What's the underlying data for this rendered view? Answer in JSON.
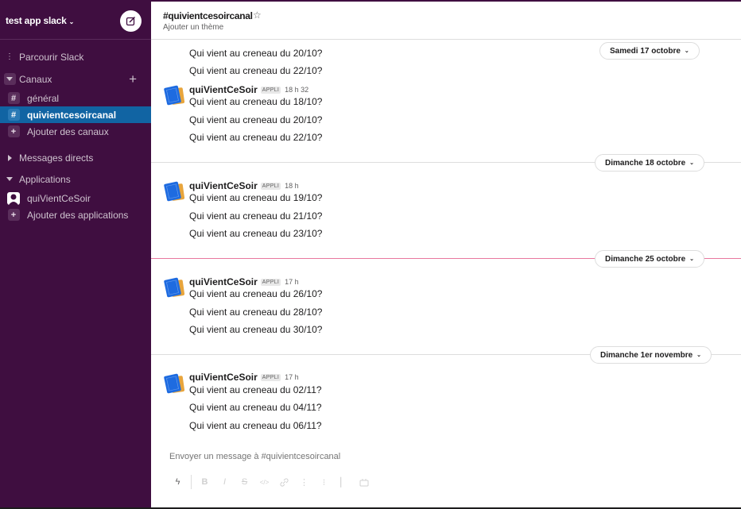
{
  "workspace": {
    "name": "test app slack",
    "compose_icon": "compose-icon"
  },
  "sidebar": {
    "browse": {
      "icon": "vertical-dots-icon",
      "label": "Parcourir Slack"
    },
    "channels_section": {
      "label": "Canaux",
      "add_icon": "plus-icon"
    },
    "channels": [
      {
        "label": "général",
        "icon": "hash-icon",
        "active": false
      },
      {
        "label": "quivientcesoircanal",
        "icon": "hash-icon",
        "active": true
      }
    ],
    "add_channels": {
      "label": "Ajouter des canaux",
      "icon": "plus-icon"
    },
    "direct_messages_section": {
      "label": "Messages directs"
    },
    "apps_section": {
      "label": "Applications"
    },
    "apps": [
      {
        "label": "quiVientCeSoir",
        "icon": "bot-avatar-icon"
      }
    ],
    "add_apps": {
      "label": "Ajouter des applications",
      "icon": "plus-icon"
    }
  },
  "channel": {
    "title": "#quivientcesoircanal",
    "star_icon": "star-icon",
    "topic": "Ajouter un thème"
  },
  "messages": {
    "orphan_lines": [
      "Qui vient au creneau du 20/10?",
      "Qui vient au creneau du 22/10?"
    ],
    "groups": [
      {
        "sender": "quiVientCeSoir",
        "badge": "APPLI",
        "time": "18 h 32",
        "lines": [
          "Qui vient au creneau du 18/10?",
          "Qui vient au creneau du 20/10?",
          "Qui vient au creneau du 22/10?"
        ]
      },
      {
        "sender": "quiVientCeSoir",
        "badge": "APPLI",
        "time": "18 h",
        "lines": [
          "Qui vient au creneau du 19/10?",
          "Qui vient au creneau du 21/10?",
          "Qui vient au creneau du 23/10?"
        ]
      },
      {
        "sender": "quiVientCeSoir",
        "badge": "APPLI",
        "time": "17 h",
        "lines": [
          "Qui vient au creneau du 26/10?",
          "Qui vient au creneau du 28/10?",
          "Qui vient au creneau du 30/10?"
        ]
      },
      {
        "sender": "quiVientCeSoir",
        "badge": "APPLI",
        "time": "17 h",
        "lines": [
          "Qui vient au creneau du 02/11?",
          "Qui vient au creneau du 04/11?",
          "Qui vient au creneau du 06/11?"
        ]
      }
    ],
    "date_dividers": [
      {
        "label": "Samedi 17 octobre",
        "new_marker": false
      },
      {
        "label": "Dimanche 18 octobre",
        "new_marker": false
      },
      {
        "label": "Dimanche 25 octobre",
        "new_marker": true
      },
      {
        "label": "Dimanche 1er novembre",
        "new_marker": false
      }
    ]
  },
  "composer": {
    "placeholder": "Envoyer un message à #quivientcesoircanal",
    "toolbar": [
      {
        "name": "shortcuts",
        "glyph": "ϟ"
      },
      {
        "name": "bold",
        "glyph": "B"
      },
      {
        "name": "italic",
        "glyph": "I"
      },
      {
        "name": "strikethrough",
        "glyph": "S"
      },
      {
        "name": "code",
        "glyph": "</>"
      },
      {
        "name": "link",
        "glyph": "🔗"
      },
      {
        "name": "ordered-list",
        "glyph": "⋮"
      },
      {
        "name": "bulleted-list",
        "glyph": "⁝"
      },
      {
        "name": "blockquote",
        "glyph": "▏"
      },
      {
        "name": "code-block",
        "glyph": "⌧"
      }
    ]
  }
}
